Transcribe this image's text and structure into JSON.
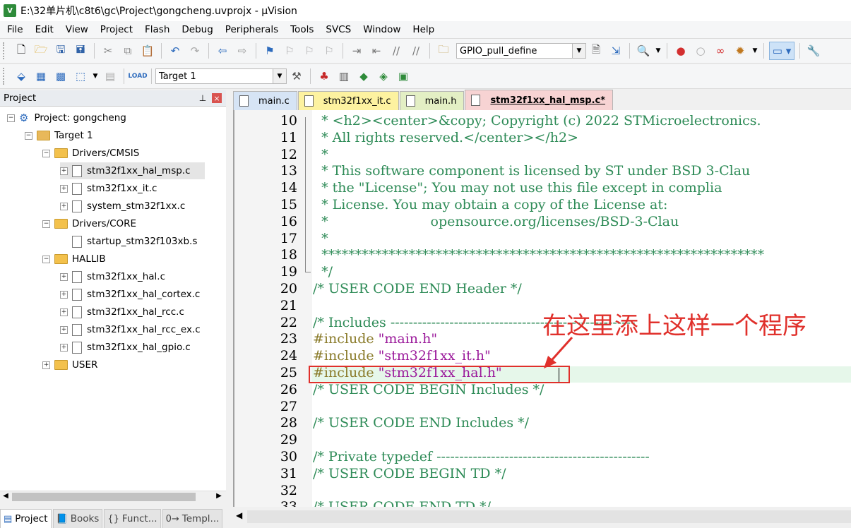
{
  "window": {
    "title": "E:\\32单片机\\c8t6\\gc\\Project\\gongcheng.uvprojx - µVision",
    "app_icon": "V"
  },
  "menu": [
    "File",
    "Edit",
    "View",
    "Project",
    "Flash",
    "Debug",
    "Peripherals",
    "Tools",
    "SVCS",
    "Window",
    "Help"
  ],
  "toolbar1": {
    "find_combo_value": "GPIO_pull_define"
  },
  "toolbar2": {
    "target_combo_value": "Target 1"
  },
  "project_panel": {
    "title": "Project",
    "tree": [
      {
        "label": "Project: gongcheng",
        "level": 0,
        "kind": "project",
        "expander": "−"
      },
      {
        "label": "Target 1",
        "level": 1,
        "kind": "target",
        "expander": "−"
      },
      {
        "label": "Drivers/CMSIS",
        "level": 2,
        "kind": "folder",
        "expander": "−"
      },
      {
        "label": "stm32f1xx_hal_msp.c",
        "level": 3,
        "kind": "file",
        "expander": "+",
        "selected": true
      },
      {
        "label": "stm32f1xx_it.c",
        "level": 3,
        "kind": "file",
        "expander": "+"
      },
      {
        "label": "system_stm32f1xx.c",
        "level": 3,
        "kind": "file",
        "expander": "+"
      },
      {
        "label": "Drivers/CORE",
        "level": 2,
        "kind": "folder",
        "expander": "−"
      },
      {
        "label": "startup_stm32f103xb.s",
        "level": 3,
        "kind": "file",
        "expander": ""
      },
      {
        "label": "HALLIB",
        "level": 2,
        "kind": "folder",
        "expander": "−"
      },
      {
        "label": "stm32f1xx_hal.c",
        "level": 3,
        "kind": "file",
        "expander": "+"
      },
      {
        "label": "stm32f1xx_hal_cortex.c",
        "level": 3,
        "kind": "file",
        "expander": "+"
      },
      {
        "label": "stm32f1xx_hal_rcc.c",
        "level": 3,
        "kind": "file",
        "expander": "+"
      },
      {
        "label": "stm32f1xx_hal_rcc_ex.c",
        "level": 3,
        "kind": "file",
        "expander": "+"
      },
      {
        "label": "stm32f1xx_hal_gpio.c",
        "level": 3,
        "kind": "file",
        "expander": "+"
      },
      {
        "label": "USER",
        "level": 2,
        "kind": "folder",
        "expander": "+"
      }
    ]
  },
  "bottom_tabs": [
    {
      "label": "Project",
      "icon": "project-icon",
      "active": true
    },
    {
      "label": "Books",
      "icon": "books-icon"
    },
    {
      "label": "Funct...",
      "icon": "functions-icon",
      "glyph": "{}"
    },
    {
      "label": "Templ...",
      "icon": "templates-icon",
      "glyph": "0→"
    }
  ],
  "editor_tabs": [
    {
      "label": "main.c",
      "bg": "#d6e4f5"
    },
    {
      "label": "stm32f1xx_it.c",
      "bg": "#fdf2a0"
    },
    {
      "label": "main.h",
      "bg": "#e3efc4"
    },
    {
      "label": "stm32f1xx_hal_msp.c*",
      "bg": "#f7d3d3",
      "active": true
    }
  ],
  "code_lines": [
    {
      "n": "10",
      "text": "  * <h2><center>&copy; Copyright (c) 2022 STMicroelectronics.",
      "cls": "c-com"
    },
    {
      "n": "11",
      "text": "  * All rights reserved.</center></h2>",
      "cls": "c-com"
    },
    {
      "n": "12",
      "text": "  *",
      "cls": "c-com"
    },
    {
      "n": "13",
      "text": "  * This software component is licensed by ST under BSD 3-Clau",
      "cls": "c-com"
    },
    {
      "n": "14",
      "text": "  * the \"License\"; You may not use this file except in complia",
      "cls": "c-com"
    },
    {
      "n": "15",
      "text": "  * License. You may obtain a copy of the License at:",
      "cls": "c-com"
    },
    {
      "n": "16",
      "text": "  *                        opensource.org/licenses/BSD-3-Clau",
      "cls": "c-com"
    },
    {
      "n": "17",
      "text": "  *",
      "cls": "c-com"
    },
    {
      "n": "18",
      "text": "  ******************************************************************",
      "cls": "c-com"
    },
    {
      "n": "19",
      "text": "  */",
      "cls": "c-com"
    },
    {
      "n": "20",
      "text": "/* USER CODE END Header */",
      "cls": "c-com"
    },
    {
      "n": "21",
      "text": "",
      "cls": "c-com"
    },
    {
      "n": "22",
      "text": "/* Includes ------------------------------------------------------",
      "cls": "c-com"
    },
    {
      "n": "23",
      "pp": "#include ",
      "str": "\"main.h\""
    },
    {
      "n": "24",
      "pp": "#include ",
      "str": "\"stm32f1xx_it.h\""
    },
    {
      "n": "25",
      "pp": "#include ",
      "str": "\"stm32f1xx_hal.h\""
    },
    {
      "n": "26",
      "text": "/* USER CODE BEGIN Includes */",
      "cls": "c-com"
    },
    {
      "n": "27",
      "text": "",
      "cls": "c-com"
    },
    {
      "n": "28",
      "text": "/* USER CODE END Includes */",
      "cls": "c-com"
    },
    {
      "n": "29",
      "text": "",
      "cls": "c-com"
    },
    {
      "n": "30",
      "text": "/* Private typedef -----------------------------------------------",
      "cls": "c-com"
    },
    {
      "n": "31",
      "text": "/* USER CODE BEGIN TD */",
      "cls": "c-com"
    },
    {
      "n": "32",
      "text": "",
      "cls": "c-com"
    },
    {
      "n": "33",
      "text": "/* USER CODE END TD */",
      "cls": "c-com"
    }
  ],
  "annotation": {
    "text": "在这里添上这样一个程序",
    "color": "#e0302b"
  }
}
